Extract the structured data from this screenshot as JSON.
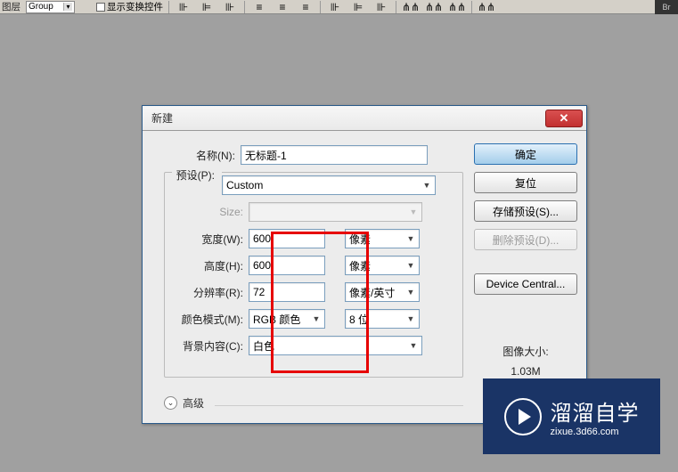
{
  "toolbar": {
    "label_layer": "图层",
    "dropdown_value": "Group",
    "checkbox_label": "显示变换控件"
  },
  "dialog": {
    "title": "新建",
    "labels": {
      "name": "名称(N):",
      "preset": "预设(P):",
      "size": "Size:",
      "width": "宽度(W):",
      "height": "高度(H):",
      "resolution": "分辨率(R):",
      "color_mode": "颜色模式(M):",
      "bg_content": "背景内容(C):",
      "advanced": "高级",
      "image_size": "图像大小:"
    },
    "values": {
      "name": "无标题-1",
      "preset": "Custom",
      "size": "",
      "width": "600",
      "height": "600",
      "resolution": "72",
      "width_unit": "像素",
      "height_unit": "像素",
      "resolution_unit": "像素/英寸",
      "color_mode": "RGB 颜色",
      "bit_depth": "8 位",
      "bg_content": "白色",
      "image_size_value": "1.03M"
    },
    "buttons": {
      "ok": "确定",
      "reset": "复位",
      "save_preset": "存储预设(S)...",
      "delete_preset": "删除预设(D)...",
      "device_central": "Device Central..."
    }
  },
  "watermark": {
    "main": "溜溜自学",
    "sub": "zixue.3d66.com"
  },
  "corner_icon": "Br"
}
